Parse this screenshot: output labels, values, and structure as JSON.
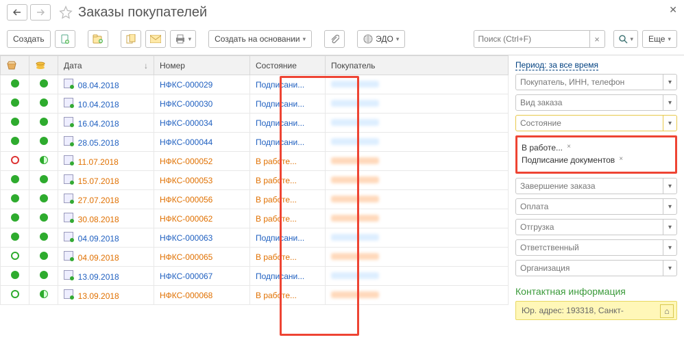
{
  "title": "Заказы покупателей",
  "toolbar": {
    "create": "Создать",
    "create_based": "Создать на основании",
    "print": "",
    "edo": "ЭДО",
    "more": "Еще"
  },
  "search": {
    "placeholder": "Поиск (Ctrl+F)"
  },
  "columns": {
    "date": "Дата",
    "number": "Номер",
    "state": "Состояние",
    "buyer": "Покупатель"
  },
  "rows": [
    {
      "s1": "green",
      "s2": "green",
      "date": "08.04.2018",
      "num": "НФКС-000029",
      "state": "Подписани...",
      "tone": "blue"
    },
    {
      "s1": "green",
      "s2": "green",
      "date": "10.04.2018",
      "num": "НФКС-000030",
      "state": "Подписани...",
      "tone": "blue"
    },
    {
      "s1": "green",
      "s2": "green",
      "date": "16.04.2018",
      "num": "НФКС-000034",
      "state": "Подписани...",
      "tone": "blue"
    },
    {
      "s1": "green",
      "s2": "green",
      "date": "28.05.2018",
      "num": "НФКС-000044",
      "state": "Подписани...",
      "tone": "blue"
    },
    {
      "s1": "red-ring",
      "s2": "half",
      "date": "11.07.2018",
      "num": "НФКС-000052",
      "state": "В работе...",
      "tone": "orange"
    },
    {
      "s1": "green",
      "s2": "green",
      "date": "15.07.2018",
      "num": "НФКС-000053",
      "state": "В работе...",
      "tone": "orange"
    },
    {
      "s1": "green",
      "s2": "green",
      "date": "27.07.2018",
      "num": "НФКС-000056",
      "state": "В работе...",
      "tone": "orange"
    },
    {
      "s1": "green",
      "s2": "green",
      "date": "30.08.2018",
      "num": "НФКС-000062",
      "state": "В работе...",
      "tone": "orange"
    },
    {
      "s1": "green",
      "s2": "green",
      "date": "04.09.2018",
      "num": "НФКС-000063",
      "state": "Подписани...",
      "tone": "blue"
    },
    {
      "s1": "green-ring",
      "s2": "green",
      "date": "04.09.2018",
      "num": "НФКС-000065",
      "state": "В работе...",
      "tone": "orange"
    },
    {
      "s1": "green",
      "s2": "green",
      "date": "13.09.2018",
      "num": "НФКС-000067",
      "state": "Подписани...",
      "tone": "blue"
    },
    {
      "s1": "green-ring",
      "s2": "half",
      "date": "13.09.2018",
      "num": "НФКС-000068",
      "state": "В работе...",
      "tone": "orange"
    }
  ],
  "side": {
    "period": "Период: за все время",
    "filters": {
      "buyer": "Покупатель, ИНН, телефон",
      "order_type": "Вид заказа",
      "state": "Состояние",
      "completion": "Завершение заказа",
      "payment": "Оплата",
      "shipping": "Отгрузка",
      "responsible": "Ответственный",
      "org": "Организация"
    },
    "tags": [
      "В работе...",
      "Подписание документов"
    ],
    "contact_header": "Контактная информация",
    "addr_label": "Юр. адрес: 193318, Санкт-"
  }
}
